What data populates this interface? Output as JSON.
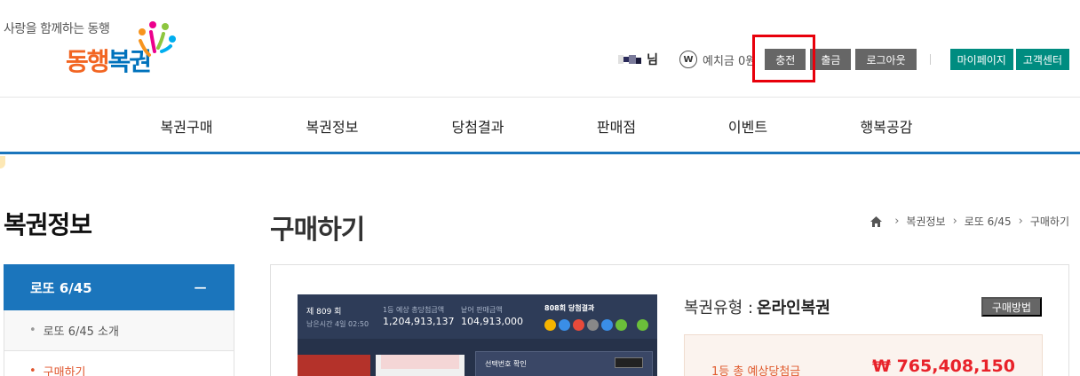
{
  "header": {
    "slogan": "사랑을 함께하는 동행",
    "logo_text_a": "동행",
    "logo_text_b": "복권",
    "user_name_suffix": "님",
    "won_symbol": "W",
    "deposit_text": "예치금 0원",
    "charge_label": "충전",
    "withdraw_label": "출금",
    "logout_label": "로그아웃",
    "mypage_label": "마이페이지",
    "support_label": "고객센터",
    "highlight_color": "#e8000b"
  },
  "nav": {
    "items": [
      "복권구매",
      "복권정보",
      "당첨결과",
      "판매점",
      "이벤트",
      "행복공감"
    ]
  },
  "sidebar": {
    "title": "복권정보",
    "active_label": "로또 6/45",
    "collapse_symbol": "−",
    "sub_items": [
      {
        "label": "로또 6/45 소개"
      },
      {
        "label": "구매하기"
      }
    ]
  },
  "content": {
    "page_title": "구매하기",
    "breadcrumb": [
      "복권정보",
      "로또 6/45",
      "구매하기"
    ],
    "lottery_type_label": "복권유형 :",
    "lottery_type_value": "온라인복권",
    "how_to_buy_label": "구매방법",
    "prize_label": "1등 총 예상당첨금",
    "prize_value": "₩ 765,408,150"
  },
  "game_preview": {
    "round_text": "제 809 회",
    "time_left_text": "남은시간 4일 02:50",
    "accum_label": "1등 예상 총당첨금액",
    "accum_value": "1,204,913,137",
    "sales_label": "낱어 판매금액",
    "sales_value": "104,913,000",
    "result_title": "808회 당첨결과",
    "panel_title": "선택번호 확인"
  },
  "colors": {
    "accent_blue": "#1b75bc",
    "teal": "#008c80",
    "orange": "#e0542c",
    "prize_red": "#e8222a"
  }
}
